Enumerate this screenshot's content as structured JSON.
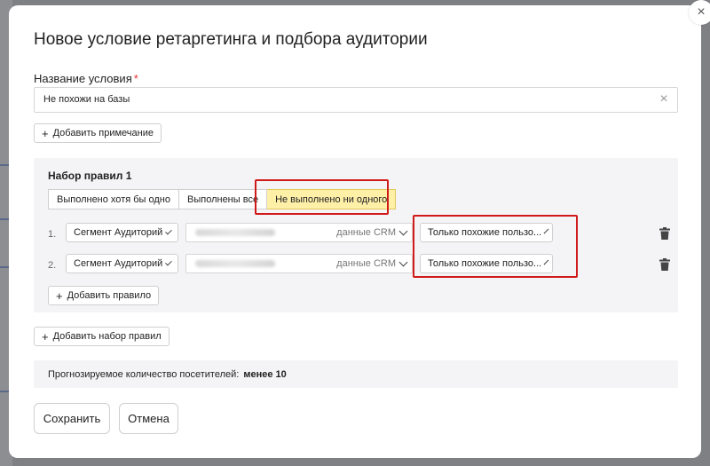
{
  "modal": {
    "title": "Новое условие ретаргетинга и подбора аудитории",
    "close_icon": "×"
  },
  "name_field": {
    "label": "Название условия",
    "required_mark": "*",
    "value": "Не похожи на базы",
    "clear_icon": "×"
  },
  "add_note_button": {
    "icon": "+",
    "label": "Добавить примечание"
  },
  "ruleset": {
    "title": "Набор правил 1",
    "modes": [
      {
        "label": "Выполнено хотя бы одно",
        "active": false
      },
      {
        "label": "Выполнены все",
        "active": false
      },
      {
        "label": "Не выполнено ни одного",
        "active": true
      }
    ],
    "rules": [
      {
        "number": "1.",
        "type": "Сегмент Аудиторий",
        "source_tag": "данные CRM",
        "condition": "Только похожие пользо..."
      },
      {
        "number": "2.",
        "type": "Сегмент Аудиторий",
        "source_tag": "данные CRM",
        "condition": "Только похожие пользо..."
      }
    ],
    "add_rule_button": {
      "icon": "+",
      "label": "Добавить правило"
    }
  },
  "add_ruleset_button": {
    "icon": "+",
    "label": "Добавить набор правил"
  },
  "forecast": {
    "label": "Прогнозируемое количество посетителей:",
    "value": "менее 10"
  },
  "actions": {
    "save": "Сохранить",
    "cancel": "Отмена"
  },
  "colors": {
    "active_mode": "#fff0a8",
    "highlight_border": "#d01a1a",
    "panel_bg": "#f4f4f6"
  }
}
